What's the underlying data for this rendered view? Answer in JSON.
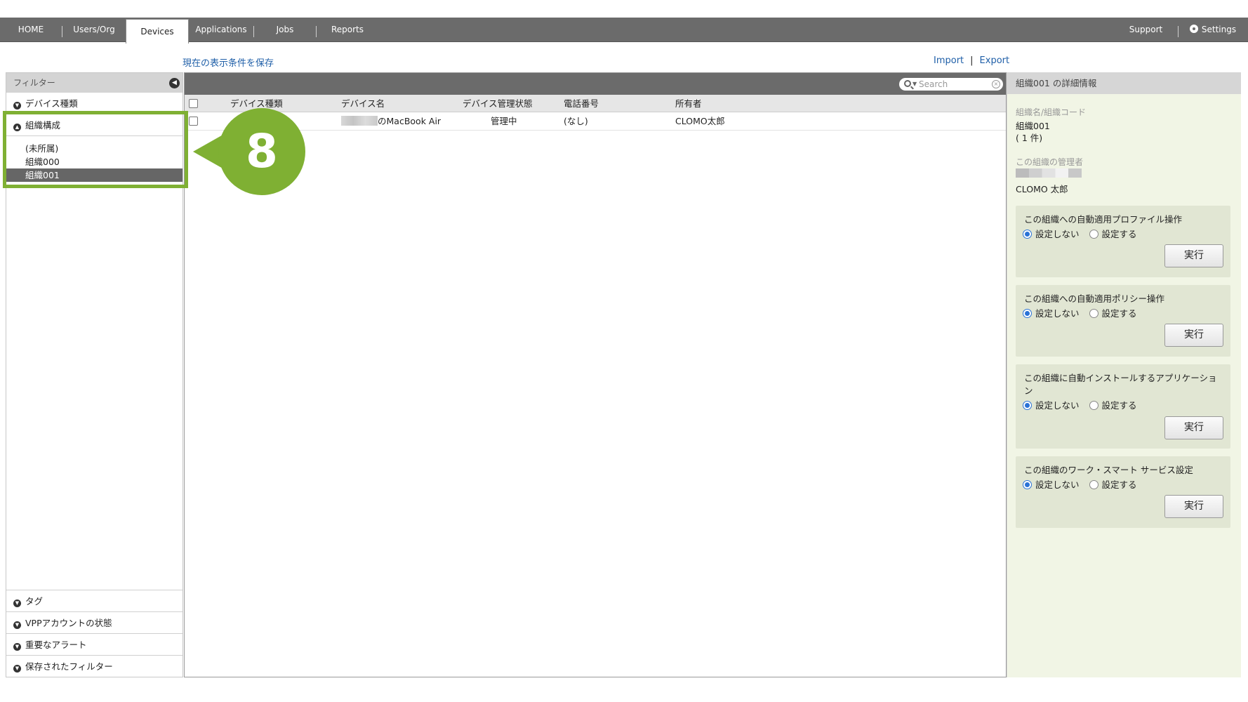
{
  "nav": {
    "home": "HOME",
    "users_org": "Users/Org",
    "devices": "Devices",
    "applications": "Applications",
    "jobs": "Jobs",
    "reports": "Reports",
    "support": "Support",
    "settings": "Settings"
  },
  "toolbar": {
    "save_view": "現在の表示条件を保存",
    "import": "Import",
    "separator": "|",
    "export": "Export"
  },
  "sidebar": {
    "title": "フィルター",
    "device_type": "デバイス種類",
    "org_structure": "組織構成",
    "orgs": [
      "(未所属)",
      "組織000",
      "組織001"
    ],
    "tag": "タグ",
    "vpp_status": "VPPアカウントの状態",
    "important_alerts": "重要なアラート",
    "saved_filters": "保存されたフィルター"
  },
  "annotation": {
    "step": "8",
    "color": "#7fb033"
  },
  "search": {
    "placeholder": "Search"
  },
  "table": {
    "headers": {
      "device_type": "デバイス種類",
      "device_name": "デバイス名",
      "mgmt_status": "デバイス管理状態",
      "phone": "電話番号",
      "owner": "所有者"
    },
    "rows": [
      {
        "device_name": "のMacBook Air",
        "mgmt_status": "管理中",
        "phone": "(なし)",
        "owner": "CLOMO太郎"
      }
    ]
  },
  "detail": {
    "title": "組織001 の詳細情報",
    "name_label": "組織名/組織コード",
    "name_value": "組織001",
    "count": "( 1 件)",
    "manager_label": "この組織の管理者",
    "manager_name": "CLOMO 太郎",
    "radio_off": "設定しない",
    "radio_on": "設定する",
    "execute": "実行",
    "ops": [
      "この組織への自動適用プロファイル操作",
      "この組織への自動適用ポリシー操作",
      "この組織に自動インストールするアプリケーション",
      "この組織のワーク・スマート サービス設定"
    ]
  }
}
